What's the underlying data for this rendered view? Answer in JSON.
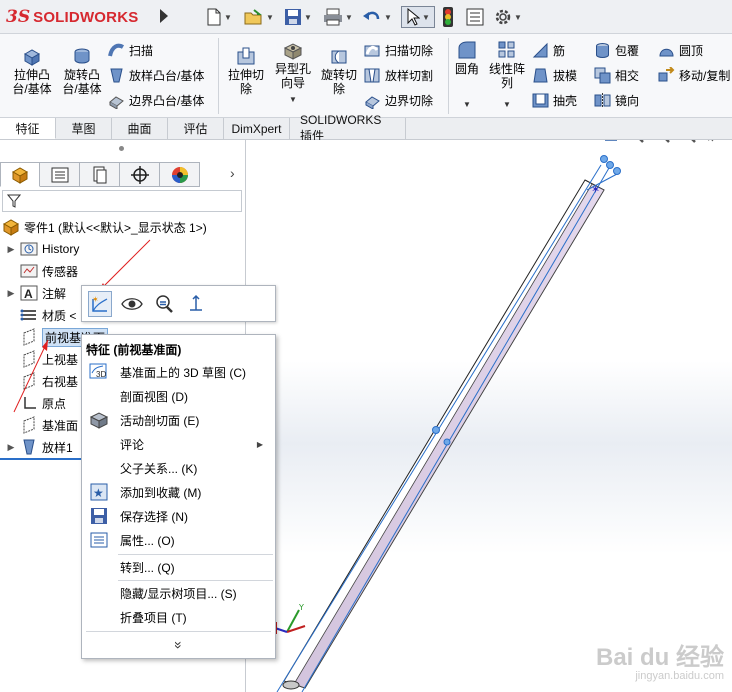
{
  "app": {
    "brand_mark": "3S",
    "brand_name": "SOLIDWORKS"
  },
  "ribbon": {
    "extrude_boss": "拉伸凸\n台/基体",
    "revolve_boss": "旋转凸\n台/基体",
    "sweep": "扫描",
    "loft_boss": "放样凸台/基体",
    "boundary_boss": "边界凸台/基体",
    "extrude_cut": "拉伸切\n除",
    "hole_wizard": "异型孔\n向导",
    "revolve_cut": "旋转切\n除",
    "swept_cut": "扫描切除",
    "lofted_cut": "放样切割",
    "boundary_cut": "边界切除",
    "fillet": "圆角",
    "linear_pattern": "线性阵\n列",
    "rib": "筋",
    "draft": "拔模",
    "shell": "抽壳",
    "wrap": "包覆",
    "intersect": "相交",
    "mirror": "镜向",
    "dome": "圆顶",
    "move_copy": "移动/复制"
  },
  "tabs": [
    {
      "label": "特征"
    },
    {
      "label": "草图"
    },
    {
      "label": "曲面"
    },
    {
      "label": "评估"
    },
    {
      "label": "DimXpert"
    },
    {
      "label": "SOLIDWORKS 插件"
    }
  ],
  "tree": {
    "root": "零件1 (默认<<默认>_显示状态 1>)",
    "items": [
      {
        "label": "History"
      },
      {
        "label": "传感器"
      },
      {
        "label": "注解"
      },
      {
        "label": "材质 <"
      },
      {
        "label": "前视基准面"
      },
      {
        "label": "上视基"
      },
      {
        "label": "右视基"
      },
      {
        "label": "原点"
      },
      {
        "label": "基准面"
      },
      {
        "label": "放样1"
      }
    ]
  },
  "context_menu": {
    "title": "特征 (前视基准面)",
    "items": [
      {
        "label": "基准面上的 3D 草图 (C)",
        "icon": "sketch-3d-icon"
      },
      {
        "label": "剖面视图 (D)",
        "icon": ""
      },
      {
        "label": "活动剖切面 (E)",
        "icon": "section-plane-icon"
      },
      {
        "label": "评论",
        "icon": ""
      },
      {
        "label": "父子关系... (K)",
        "icon": ""
      },
      {
        "label": "添加到收藏 (M)",
        "icon": "favorite-icon"
      },
      {
        "label": "保存选择 (N)",
        "icon": "save-selection-icon"
      },
      {
        "label": "属性... (O)",
        "icon": "properties-icon"
      },
      {
        "label": "转到... (Q)",
        "icon": ""
      },
      {
        "label": "隐藏/显示树项目... (S)",
        "icon": ""
      },
      {
        "label": "折叠项目 (T)",
        "icon": ""
      }
    ],
    "more": "»"
  },
  "watermark": {
    "brand": "Bai du 经验",
    "url": "jingyan.baidu.com"
  },
  "colors": {
    "brand_red": "#d6282f",
    "accent_blue": "#2a6fc9",
    "annotation_red": "#e02020",
    "part_fill": "#d9c9e0"
  }
}
